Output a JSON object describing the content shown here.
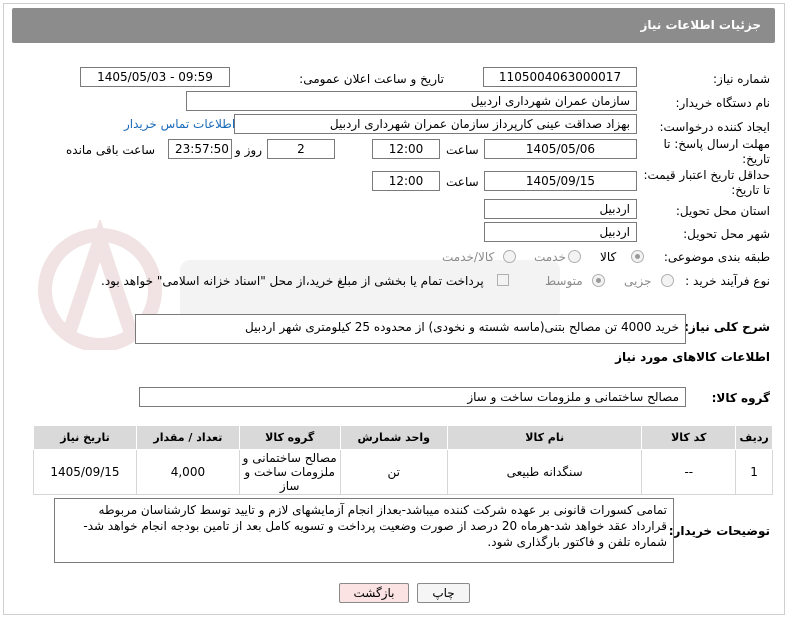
{
  "header": {
    "title": "جزئیات اطلاعات نیاز"
  },
  "fields": {
    "need_number_label": "شماره نیاز:",
    "need_number": "1105004063000017",
    "announce_label": "تاریخ و ساعت اعلان عمومی:",
    "announce_value": "1405/05/03 - 09:59",
    "buyer_org_label": "نام دستگاه خریدار:",
    "buyer_org": "سازمان عمران شهرداری اردبیل",
    "requester_label": "ایجاد کننده درخواست:",
    "requester": "بهزاد  صداقت عینی کارپرداز سازمان عمران شهرداری اردبیل",
    "contact_link": "اطلاعات تماس خریدار",
    "deadline_label_1": "مهلت ارسال پاسخ: تا",
    "deadline_label_2": "تاریخ:",
    "deadline_date": "1405/05/06",
    "hour_label": "ساعت",
    "deadline_time": "12:00",
    "days_value": "2",
    "days_label": "روز و",
    "remaining_value": "23:57:50",
    "remaining_label": "ساعت باقی مانده",
    "validity_label_1": "حداقل تاریخ اعتبار قیمت:",
    "validity_label_2": "تا تاریخ:",
    "validity_date": "1405/09/15",
    "validity_time": "12:00",
    "province_label": "استان محل تحویل:",
    "province": "اردبیل",
    "city_label": "شهر محل تحویل:",
    "city": "اردبیل",
    "category_label": "طبقه بندی موضوعی:",
    "category_options": [
      "کالا",
      "خدمت",
      "کالا/خدمت"
    ],
    "process_label": "نوع فرآیند خرید :",
    "process_options": [
      "جزیی",
      "متوسط"
    ],
    "payment_note": "پرداخت تمام یا بخشی از مبلغ خرید،از محل \"اسناد خزانه اسلامی\" خواهد بود."
  },
  "summary": {
    "label": "شرح کلی نیاز:",
    "text": "خرید 4000 تن مصالح بتنی(ماسه شسته و نخودی) از محدوده 25 کیلومتری شهر اردبیل"
  },
  "goods_section": {
    "title": "اطلاعات کالاهای مورد نیاز",
    "group_label": "گروه کالا:",
    "group_value": "مصالح ساختمانی و ملزومات ساخت و ساز"
  },
  "table": {
    "headers": [
      "ردیف",
      "کد کالا",
      "نام کالا",
      "واحد شمارش",
      "گروه کالا",
      "تعداد / مقدار",
      "تاریخ نیاز"
    ],
    "rows": [
      [
        "1",
        "--",
        "سنگدانه طبیعی",
        "تن",
        "مصالح ساختمانی و ملزومات ساخت و ساز",
        "4,000",
        "1405/09/15"
      ]
    ]
  },
  "buyer_notes": {
    "label": "توضیحات خریدار:",
    "text": "تمامی کسورات قانونی بر عهده شرکت کننده میباشد-بعداز انجام آزمایشهای لازم و تایید توسط کارشناسان مربوطه قرارداد عقد خواهد شد-هرماه 20 درصد از صورت وضعیت پرداخت و تسویه کامل بعد از تامین بودجه انجام خواهد شد-شماره تلفن و فاکتور بارگذاری شود."
  },
  "buttons": {
    "print": "چاپ",
    "back": "بازگشت"
  },
  "colors": {
    "header_bg": "#8c8c8c",
    "link": "#1a6bb8",
    "back_btn_bg": "#fbe3e3",
    "table_header_bg": "#d9d9d9"
  }
}
